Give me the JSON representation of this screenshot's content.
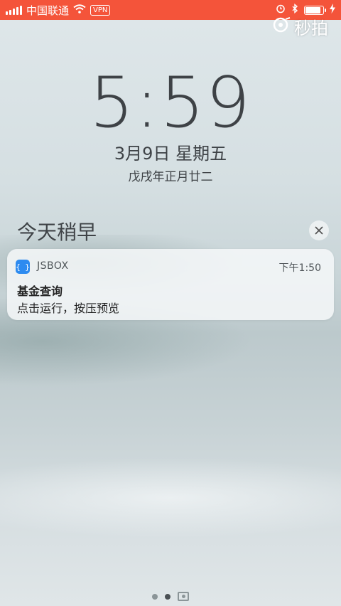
{
  "status_bar": {
    "carrier": "中国联通",
    "vpn": "VPN",
    "background_color": "#f4543a",
    "icons": [
      "signal-icon",
      "wifi-icon",
      "alarm-icon",
      "bluetooth-icon",
      "battery-icon",
      "charging-icon"
    ]
  },
  "watermark": {
    "text": "秒拍"
  },
  "lockscreen": {
    "time": "5:59",
    "date": "3月9日 星期五",
    "lunar_date": "戊戌年正月廿二"
  },
  "notifications_section": {
    "title": "今天稍早",
    "clear_icon": "close-icon"
  },
  "notification": {
    "app_name": "JSBOX",
    "app_icon_glyph": "{ }",
    "app_icon_color": "#2d8bf0",
    "time": "下午1:50",
    "title": "基金查询",
    "body": "点击运行，按压预览"
  },
  "pager": {
    "pages": 3,
    "current_page": 2,
    "icons": [
      "dot-icon",
      "dot-icon",
      "camera-icon"
    ]
  }
}
